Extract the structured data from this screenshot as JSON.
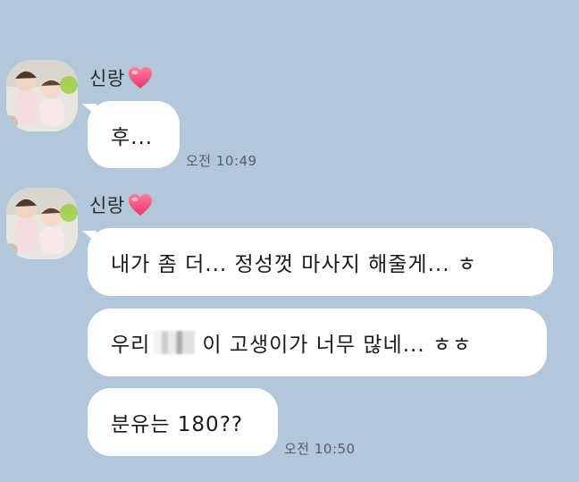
{
  "chat": {
    "background_color": "#b2c7da",
    "groups": [
      {
        "sender": "신랑",
        "sender_badge": "heart-icon",
        "messages": [
          {
            "text": "후...",
            "time": "오전 10:49"
          }
        ]
      },
      {
        "sender": "신랑",
        "sender_badge": "heart-icon",
        "messages": [
          {
            "text": "내가 좀 더... 정성껏 마사지 해줄게... ㅎ"
          },
          {
            "text_before": "우리",
            "text_after": "이 고생이가 너무 많네... ㅎㅎ"
          },
          {
            "text": "분유는 180??",
            "time": "오전 10:50"
          }
        ]
      }
    ]
  }
}
